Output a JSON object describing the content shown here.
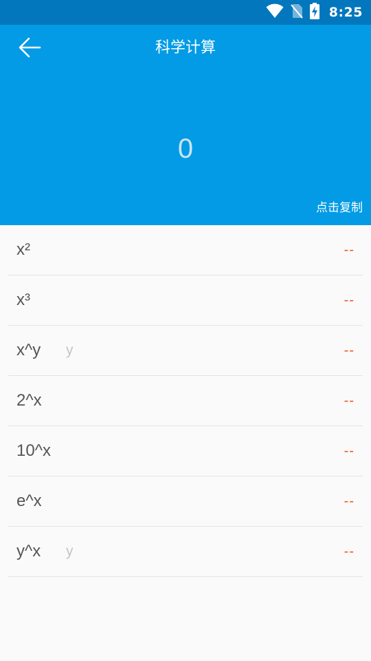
{
  "status_bar": {
    "time": "8:25",
    "icons": [
      "wifi-icon",
      "no-sim-icon",
      "battery-charging-icon"
    ]
  },
  "header": {
    "title": "科学计算",
    "result": "0",
    "copy_label": "点击复制"
  },
  "operations": [
    {
      "label": "x²",
      "has_input": false,
      "value": "--"
    },
    {
      "label": "x³",
      "has_input": false,
      "value": "--"
    },
    {
      "label": "x^y",
      "has_input": true,
      "placeholder": "y",
      "value": "--"
    },
    {
      "label": "2^x",
      "has_input": false,
      "value": "--"
    },
    {
      "label": "10^x",
      "has_input": false,
      "value": "--"
    },
    {
      "label": "e^x",
      "has_input": false,
      "value": "--"
    },
    {
      "label": "y^x",
      "has_input": true,
      "placeholder": "y",
      "value": "--"
    }
  ],
  "colors": {
    "status_bar": "#0277bd",
    "header": "#039be5",
    "result_text": "#cde3f2",
    "value_accent": "#f4511e",
    "background": "#fafafa"
  }
}
